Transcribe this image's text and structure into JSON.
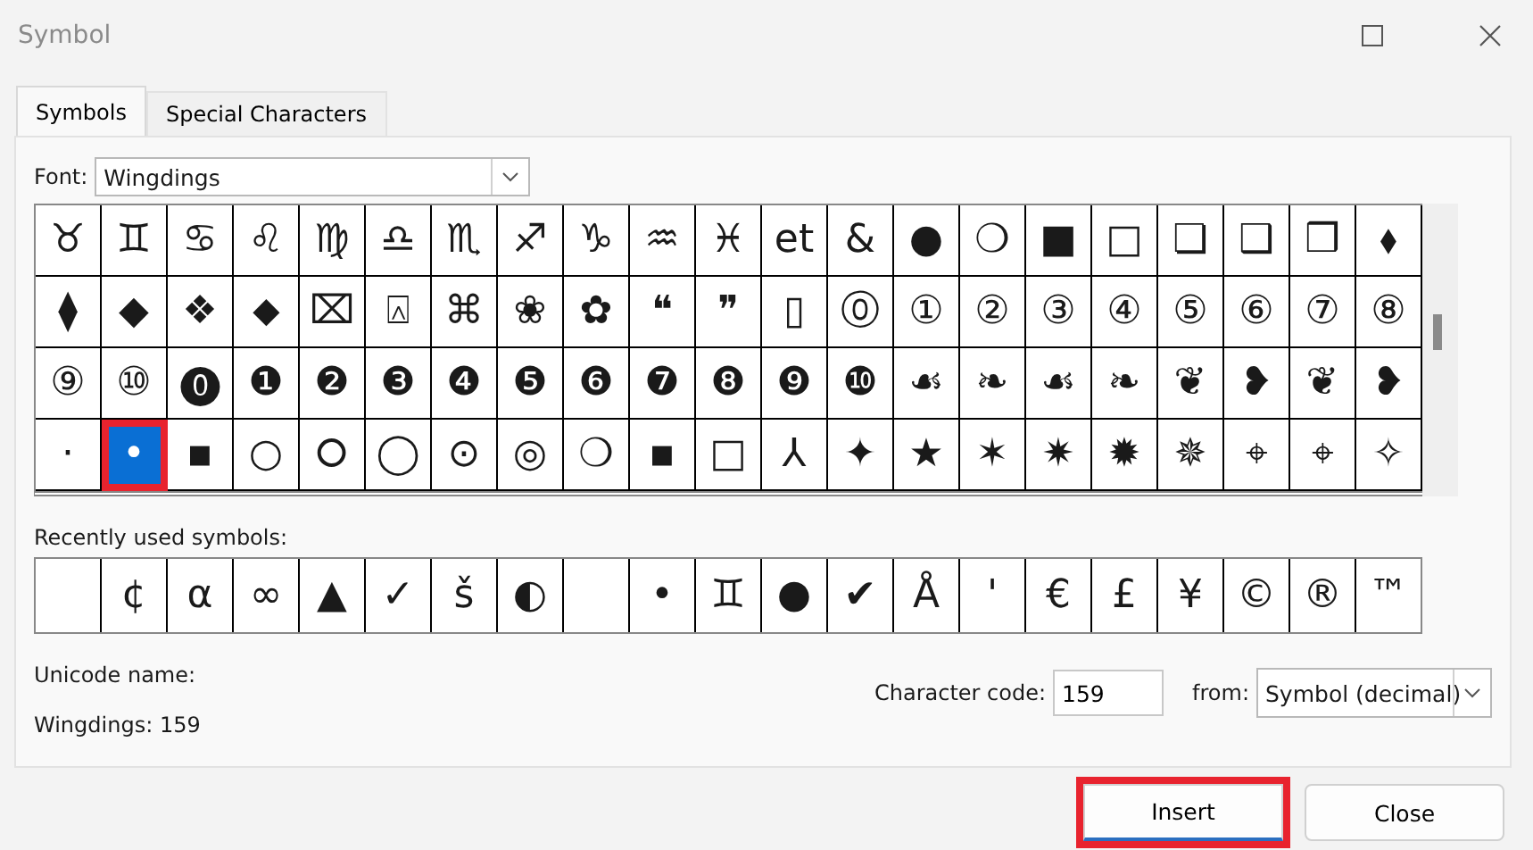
{
  "window": {
    "title": "Symbol"
  },
  "tabs": [
    {
      "label": "Symbols",
      "selected": true
    },
    {
      "label": "Special Characters",
      "selected": false
    }
  ],
  "font": {
    "label": "Font:",
    "value": "Wingdings"
  },
  "symbol_grid": [
    [
      {
        "symbol": "♉",
        "selected": false
      },
      {
        "symbol": "♊",
        "selected": false
      },
      {
        "symbol": "♋",
        "selected": false
      },
      {
        "symbol": "♌",
        "selected": false
      },
      {
        "symbol": "♍",
        "selected": false
      },
      {
        "symbol": "♎",
        "selected": false
      },
      {
        "symbol": "♏",
        "selected": false
      },
      {
        "symbol": "♐",
        "selected": false
      },
      {
        "symbol": "♑",
        "selected": false
      },
      {
        "symbol": "♒",
        "selected": false
      },
      {
        "symbol": "♓",
        "selected": false
      },
      {
        "symbol": "et",
        "selected": false
      },
      {
        "symbol": "&",
        "selected": false
      },
      {
        "symbol": "●",
        "selected": false
      },
      {
        "symbol": "❍",
        "selected": false
      },
      {
        "symbol": "■",
        "selected": false
      },
      {
        "symbol": "□",
        "selected": false
      },
      {
        "symbol": "❏",
        "selected": false
      },
      {
        "symbol": "❑",
        "selected": false
      },
      {
        "symbol": "❒",
        "selected": false
      },
      {
        "symbol": "⬧",
        "selected": false
      }
    ],
    [
      {
        "symbol": "⧫",
        "selected": false
      },
      {
        "symbol": "◆",
        "selected": false
      },
      {
        "symbol": "❖",
        "selected": false
      },
      {
        "symbol": "⬥",
        "selected": false
      },
      {
        "symbol": "⌧",
        "selected": false
      },
      {
        "symbol": "⍓",
        "selected": false
      },
      {
        "symbol": "⌘",
        "selected": false
      },
      {
        "symbol": "❀",
        "selected": false
      },
      {
        "symbol": "✿",
        "selected": false
      },
      {
        "symbol": "❝",
        "selected": false
      },
      {
        "symbol": "❞",
        "selected": false
      },
      {
        "symbol": "▯",
        "selected": false
      },
      {
        "symbol": "⓪",
        "selected": false
      },
      {
        "symbol": "①",
        "selected": false
      },
      {
        "symbol": "②",
        "selected": false
      },
      {
        "symbol": "③",
        "selected": false
      },
      {
        "symbol": "④",
        "selected": false
      },
      {
        "symbol": "⑤",
        "selected": false
      },
      {
        "symbol": "⑥",
        "selected": false
      },
      {
        "symbol": "⑦",
        "selected": false
      },
      {
        "symbol": "⑧",
        "selected": false
      }
    ],
    [
      {
        "symbol": "⑨",
        "selected": false
      },
      {
        "symbol": "⑩",
        "selected": false
      },
      {
        "symbol": "⓿",
        "selected": false
      },
      {
        "symbol": "❶",
        "selected": false
      },
      {
        "symbol": "❷",
        "selected": false
      },
      {
        "symbol": "❸",
        "selected": false
      },
      {
        "symbol": "❹",
        "selected": false
      },
      {
        "symbol": "❺",
        "selected": false
      },
      {
        "symbol": "❻",
        "selected": false
      },
      {
        "symbol": "❼",
        "selected": false
      },
      {
        "symbol": "❽",
        "selected": false
      },
      {
        "symbol": "❾",
        "selected": false
      },
      {
        "symbol": "❿",
        "selected": false
      },
      {
        "symbol": "☙",
        "selected": false
      },
      {
        "symbol": "❧",
        "selected": false
      },
      {
        "symbol": "☙",
        "selected": false
      },
      {
        "symbol": "❧",
        "selected": false
      },
      {
        "symbol": "❦",
        "selected": false
      },
      {
        "symbol": "❥",
        "selected": false
      },
      {
        "symbol": "❦",
        "selected": false
      },
      {
        "symbol": "❥",
        "selected": false
      }
    ],
    [
      {
        "symbol": "·",
        "selected": false
      },
      {
        "symbol": "•",
        "selected": true
      },
      {
        "symbol": "▪",
        "selected": false
      },
      {
        "symbol": "○",
        "selected": false
      },
      {
        "symbol": "⭘",
        "selected": false
      },
      {
        "symbol": "◯",
        "selected": false
      },
      {
        "symbol": "⊙",
        "selected": false
      },
      {
        "symbol": "◎",
        "selected": false
      },
      {
        "symbol": "❍",
        "selected": false
      },
      {
        "symbol": "▪",
        "selected": false
      },
      {
        "symbol": "□",
        "selected": false
      },
      {
        "symbol": "⅄",
        "selected": false
      },
      {
        "symbol": "✦",
        "selected": false
      },
      {
        "symbol": "★",
        "selected": false
      },
      {
        "symbol": "✶",
        "selected": false
      },
      {
        "symbol": "✷",
        "selected": false
      },
      {
        "symbol": "✹",
        "selected": false
      },
      {
        "symbol": "✵",
        "selected": false
      },
      {
        "symbol": "⌖",
        "selected": false
      },
      {
        "symbol": "⌖",
        "selected": false
      },
      {
        "symbol": "✧",
        "selected": false
      }
    ]
  ],
  "recently_used": {
    "label": "Recently used symbols:",
    "symbols": [
      {
        "kind": "blank"
      },
      {
        "kind": "glyph",
        "symbol": "¢"
      },
      {
        "kind": "glyph",
        "symbol": "α"
      },
      {
        "kind": "glyph",
        "symbol": "∞"
      },
      {
        "kind": "glyph",
        "symbol": "▲"
      },
      {
        "kind": "glyph",
        "symbol": "✓"
      },
      {
        "kind": "glyph",
        "symbol": "š"
      },
      {
        "kind": "glyph",
        "symbol": "◐"
      },
      {
        "kind": "blank"
      },
      {
        "kind": "glyph",
        "symbol": "•"
      },
      {
        "kind": "glyph",
        "symbol": "♊"
      },
      {
        "kind": "glyph",
        "symbol": "●"
      },
      {
        "kind": "glyph",
        "symbol": "✔"
      },
      {
        "kind": "glyph",
        "symbol": "Å"
      },
      {
        "kind": "glyph",
        "symbol": "'"
      },
      {
        "kind": "glyph",
        "symbol": "€"
      },
      {
        "kind": "glyph",
        "symbol": "£"
      },
      {
        "kind": "glyph",
        "symbol": "¥"
      },
      {
        "kind": "glyph",
        "symbol": "©"
      },
      {
        "kind": "glyph",
        "symbol": "®"
      },
      {
        "kind": "glyph",
        "symbol": "™"
      }
    ]
  },
  "unicode_name": {
    "label": "Unicode name:",
    "value": "Wingdings: 159"
  },
  "character_code": {
    "label": "Character code:",
    "value": "159"
  },
  "from": {
    "label": "from:",
    "value": "Symbol (decimal)"
  },
  "buttons": [
    {
      "label": "Insert",
      "highlighted": true
    },
    {
      "label": "Close",
      "highlighted": false
    }
  ]
}
